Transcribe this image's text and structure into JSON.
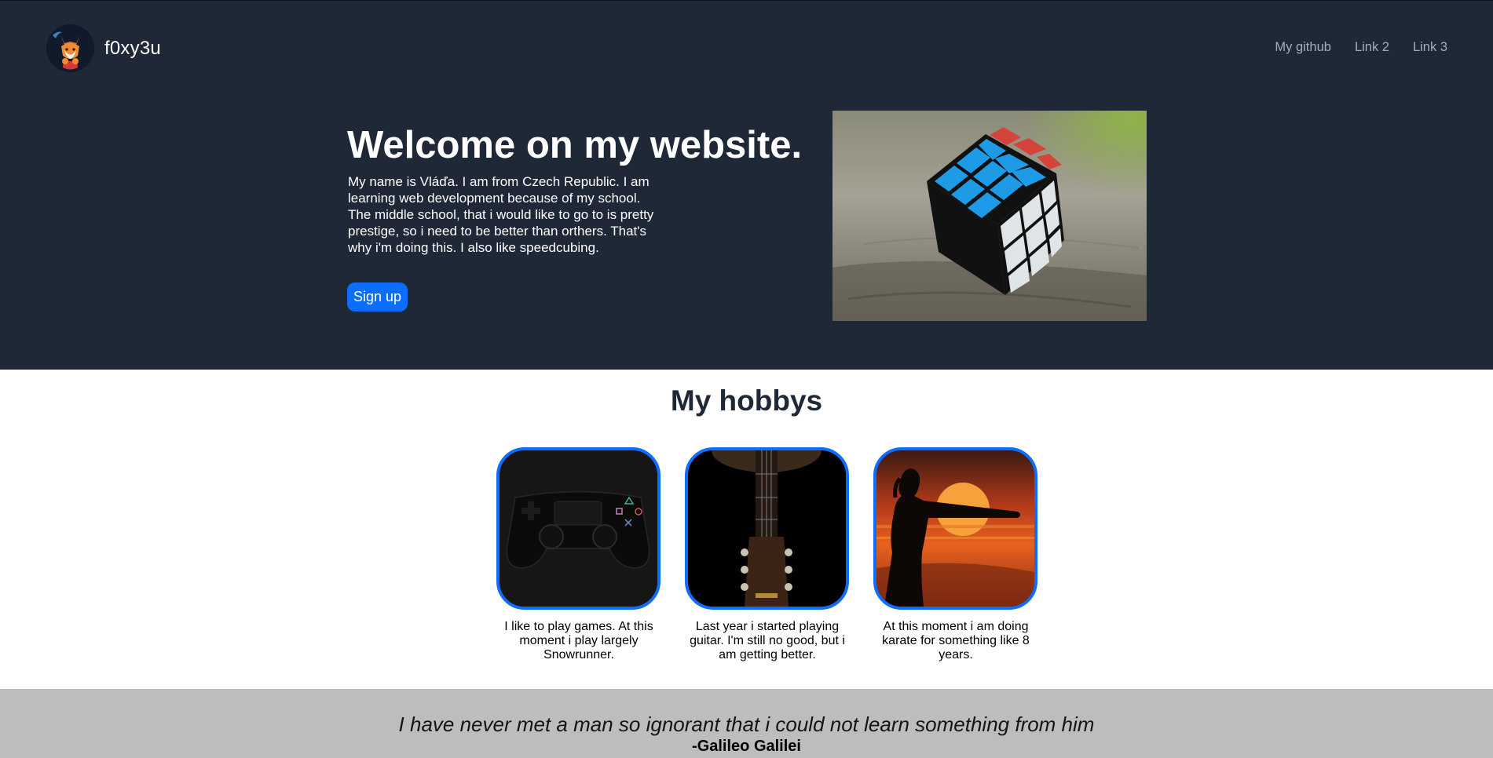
{
  "nav": {
    "brand": "f0xy3u",
    "links": [
      "My github",
      "Link 2",
      "Link 3"
    ]
  },
  "hero": {
    "title": "Welcome on my website.",
    "text": "My name is Vláďa. I am from Czech Republic. I am learning web development because of my school. The middle school, that i would like to go to is pretty prestige, so i need to be better than orthers. That's why i'm doing this. I also like speedcubing.",
    "signup_label": "Sign up"
  },
  "hobbies": {
    "title": "My hobbys",
    "items": [
      {
        "text": "I like to play games. At this moment i play largely Snowrunner.",
        "icon": "gamepad-image"
      },
      {
        "text": "Last year i started playing guitar. I'm still no good, but i am getting better.",
        "icon": "guitar-image"
      },
      {
        "text": "At this moment i am doing karate for something like 8 years.",
        "icon": "karate-image"
      }
    ]
  },
  "quote": {
    "text": "I have never met a man so ignorant that i could not learn something from him",
    "author": "-Galileo Galilei"
  },
  "colors": {
    "hero_bg": "#1f2837",
    "accent": "#0d6efd",
    "quote_bg": "#bdbdbd"
  }
}
